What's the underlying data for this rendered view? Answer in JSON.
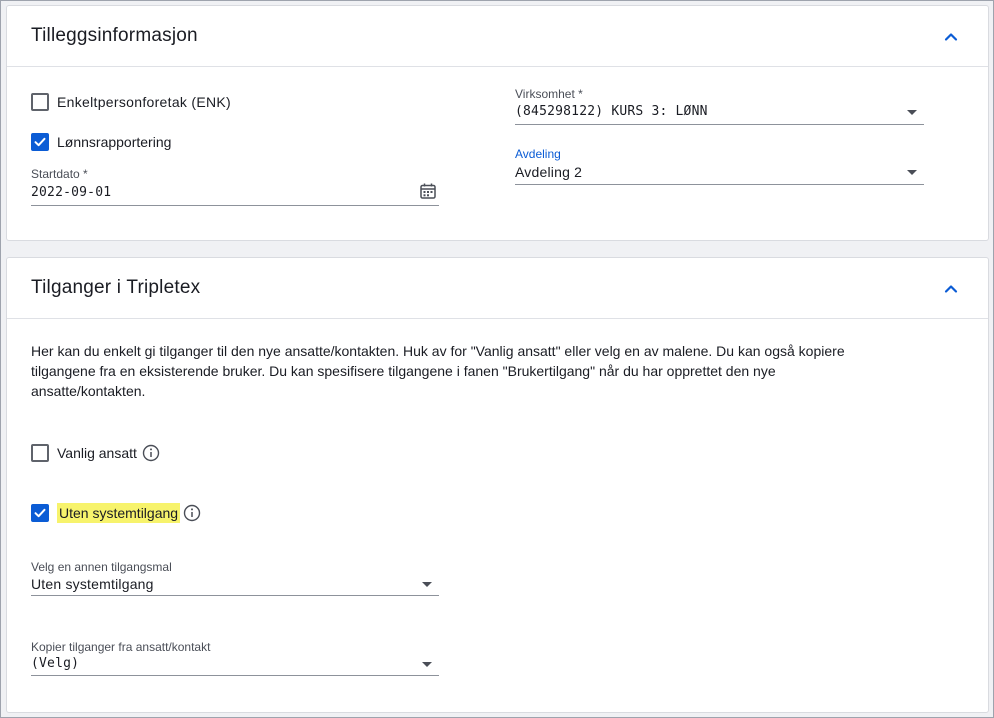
{
  "section1": {
    "title": "Tilleggsinformasjon",
    "enk_label": "Enkeltpersonforetak (ENK)",
    "enk_checked": false,
    "payroll_label": "Lønnsrapportering",
    "payroll_checked": true,
    "startdate_label": "Startdato *",
    "startdate_value": "2022-09-01",
    "company_label": "Virksomhet *",
    "company_value": "(845298122) KURS 3: LØNN",
    "department_label": "Avdeling",
    "department_value": "Avdeling 2"
  },
  "section2": {
    "title": "Tilganger i Tripletex",
    "description": "Her kan du enkelt gi tilganger til den nye ansatte/kontakten. Huk av for \"Vanlig ansatt\" eller velg en av malene. Du kan også kopiere tilgangene fra en eksisterende bruker. Du kan spesifisere tilgangene i fanen \"Brukertilgang\" når du har opprettet den nye ansatte/kontakten.",
    "regular_label": "Vanlig ansatt",
    "regular_checked": false,
    "nosystem_label": "Uten systemtilgang",
    "nosystem_checked": true,
    "template_label": "Velg en annen tilgangsmal",
    "template_value": "Uten systemtilgang",
    "copy_label": "Kopier tilganger fra ansatt/kontakt",
    "copy_value": "(Velg)"
  },
  "icons": {
    "collapse": "chevron-up-icon",
    "info": "info-icon",
    "calendar": "calendar-icon",
    "dropdown": "caret-down-icon",
    "check": "check-icon"
  },
  "colors": {
    "accent": "#0b5cd5",
    "highlight": "#f7f36c",
    "background": "#f0f1f4"
  }
}
